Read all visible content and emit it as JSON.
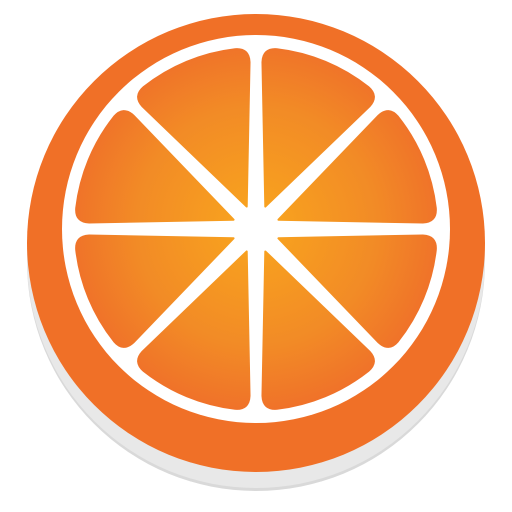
{
  "icon": {
    "name": "orange-slice-icon",
    "segments": 8
  },
  "colors": {
    "rind": "#F07027",
    "pith": "#FFFFFF",
    "pulp_center": "#F9A61D",
    "pulp_edge": "#EF6C2A",
    "shadow": "#D9D9D9"
  }
}
